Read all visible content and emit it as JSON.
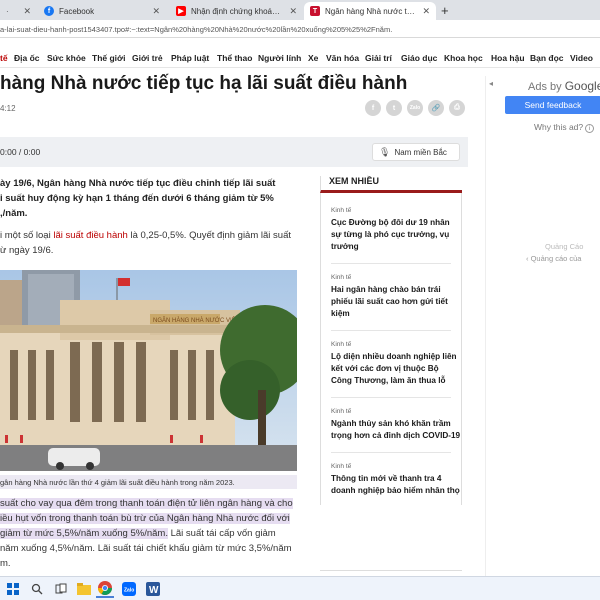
{
  "browser": {
    "tabs": [
      {
        "label": "Facebook",
        "active": false
      },
      {
        "label": "Nhận định chứng khoán | Đúng",
        "active": false
      },
      {
        "label": "Ngân hàng Nhà nước tiếp tục hạ",
        "active": true
      }
    ],
    "new_tab": "+",
    "url": "a-lai-suat-dieu-hanh-post1543407.tpo#:~:text=Ngân%20hàng%20Nhà%20nước%20lần%20xuống%205%25%2Fnăm."
  },
  "nav": [
    "tế",
    "Địa ốc",
    "Sức khỏe",
    "Thế giới",
    "Giới trẻ",
    "Pháp luật",
    "Thể thao",
    "Người lính",
    "Xe",
    "Văn hóa",
    "Giải trí",
    "Giáo dục",
    "Khoa học",
    "Hoa hậu",
    "Bạn đọc",
    "Video"
  ],
  "article": {
    "title": "hàng Nhà nước tiếp tục hạ lãi suất điều hành",
    "time": "4:12",
    "share": {
      "facebook": "f",
      "twitter": "t",
      "zalo": "Zalo",
      "link": "🔗",
      "print": "⎙"
    },
    "audio": {
      "time": "0:00 / 0:00",
      "voice": "Nam miền Bắc"
    },
    "lead_lines": [
      "ày 19/6, Ngân hàng Nhà nước tiếp tục điều chỉnh tiếp lãi suất",
      "i suất huy động kỳ hạn 1 tháng đến dưới 6 tháng giảm từ 5%",
      ",/năm."
    ],
    "para1_pre": "i một số loại ",
    "para1_link": "lãi suất điều hành",
    "para1_post": " là 0,25-0,5%. Quyết định giảm lãi suất",
    "para2": "ừ ngày 19/6.",
    "photo_sign": "NGÂN HÀNG NHÀ NƯỚC VIỆT NAM",
    "caption": "gân hàng Nhà nước lần thứ 4 giảm lãi suất điều hành trong năm 2023.",
    "hl1": "suất cho vay qua đêm trong thanh toán điện tử liên ngân hàng và cho",
    "hl2": "iều hụt vốn trong thanh toán bù trừ của Ngân hàng Nhà nước đối với",
    "hl3_mark": "giảm từ mức 5,5%/năm xuống 5%/năm.",
    "hl3_rest": " Lãi suất tái cấp vốn giảm",
    "hl4": "năm xuống 4,5%/năm. Lãi suất tái chiết khấu giảm từ mức 3,5%/năm",
    "hl5": "m."
  },
  "sidebar": {
    "heading": "XEM NHIỀU",
    "items": [
      {
        "cat": "Kinh tế",
        "title": "Cục Đường bộ đôi dư 19 nhân sự từng là phó cục trưởng, vụ trưởng"
      },
      {
        "cat": "Kinh tế",
        "title": "Hai ngân hàng chào bán trái phiếu lãi suất cao hơn gửi tiết kiệm"
      },
      {
        "cat": "Kinh tế",
        "title": "Lộ diện nhiều doanh nghiệp liên kết với các đơn vị thuộc Bộ Công Thương, làm ăn thua lỗ"
      },
      {
        "cat": "Kinh tế",
        "title": "Ngành thủy sản khó khăn trầm trọng hơn cả đỉnh dịch COVID-19"
      },
      {
        "cat": "Kinh tế",
        "title": "Thông tin mới về thanh tra 4 doanh nghiệp bảo hiểm nhân thọ"
      }
    ]
  },
  "ads": {
    "ads_by": "Ads by",
    "google": "Google",
    "send_feedback": "Send feedback",
    "why": "Why this ad?",
    "quang_cao": "Quảng Cáo",
    "quang_cao_link": "Quảng cáo của"
  },
  "taskbar": {
    "icons": [
      "windows-icon",
      "search-icon",
      "task-view-icon",
      "file-explorer-icon",
      "chrome-icon",
      "zalo-icon",
      "word-icon"
    ]
  },
  "colors": {
    "accent_red": "#9a1b1b",
    "link_red": "#b00000",
    "send_blue": "#4285f4",
    "highlight": "#e6ddf1"
  }
}
